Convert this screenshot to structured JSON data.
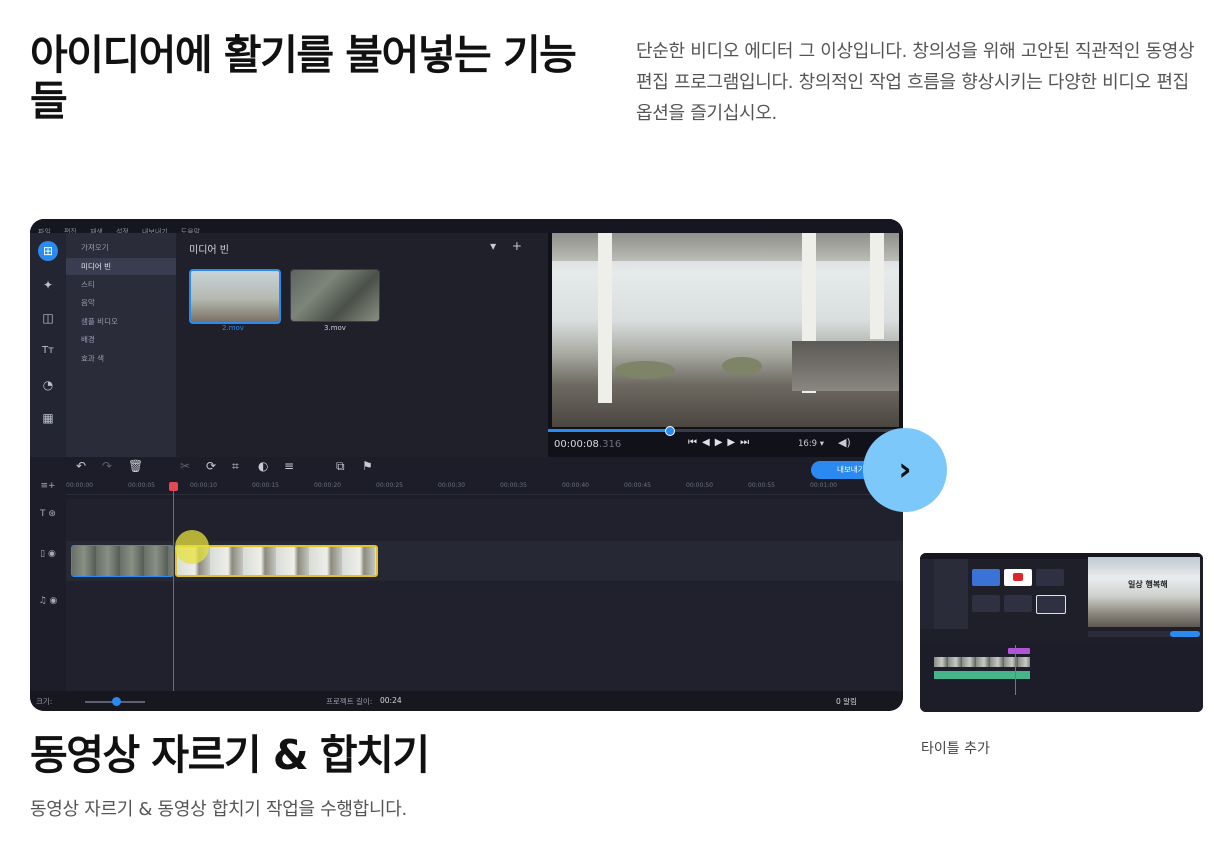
{
  "hero": {
    "title": "아이디어에 활기를 불어넣는 기능들",
    "description": "단순한 비디오 에디터 그 이상입니다. 창의성을 위해 고안된 직관적인 동영상 편집 프로그램입니다. 창의적인 작업 흐름을 향상시키는 다양한 비디오 편집 옵션을 즐기십시오."
  },
  "editor": {
    "menu": [
      "파일",
      "편집",
      "재생",
      "설정",
      "내보내기",
      "도움말"
    ],
    "nav_items": [
      "가져오기",
      "미디어 빈",
      "스티",
      "음악",
      "샘플 비디오",
      "배경",
      "효과 색"
    ],
    "active_nav_index": 1,
    "bin_title": "미디어 빈",
    "bin_actions": "▾ +",
    "clips": [
      {
        "label": "2.mov",
        "selected": true
      },
      {
        "label": "3.mov",
        "selected": false
      }
    ],
    "timecode": "00:00:08",
    "timecode_fraction": ".316",
    "aspect_ratio": "16:9 ▾",
    "export_label": "내보내기",
    "ruler_ticks": [
      "00:00:00",
      "00:00:05",
      "00:00:10",
      "00:00:15",
      "00:00:20",
      "00:00:25",
      "00:00:30",
      "00:00:35",
      "00:00:40",
      "00:00:45",
      "00:00:50",
      "00:00:55",
      "00:01:00"
    ],
    "status": {
      "zoom_label": "크기:",
      "project_length_label": "프로젝트 길이:",
      "project_length": "00:24",
      "errors": "0 알림"
    },
    "playback_progress": 0.34
  },
  "next_button": {
    "icon": "chevron-right-icon",
    "symbol": "›"
  },
  "feature": {
    "title": "동영상 자르기 & 합치기",
    "description": "동영상 자르기 & 동영상 합치기 작업을 수행합니다."
  },
  "mini_card": {
    "preview_text": "일상 행복해",
    "caption": "타이틀 추가"
  },
  "colors": {
    "accent": "#2a8af0",
    "next_button": "#7dc8fb",
    "playhead": "#e04a50",
    "selected_clip_border": "#e0c22c"
  }
}
